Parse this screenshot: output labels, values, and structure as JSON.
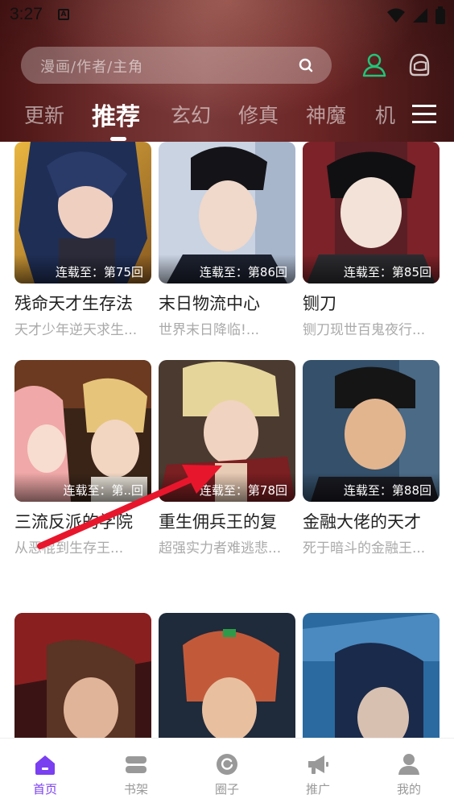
{
  "status_bar": {
    "time": "3:27",
    "a_badge": "A"
  },
  "search": {
    "placeholder": "漫画/作者/主角"
  },
  "tabs": [
    {
      "label": "更新"
    },
    {
      "label": "推荐"
    },
    {
      "label": "玄幻"
    },
    {
      "label": "修真"
    },
    {
      "label": "神魔"
    },
    {
      "label": "机"
    }
  ],
  "active_tab": "推荐",
  "comics": [
    {
      "title": "残命天才生存法",
      "desc": "天才少年逆天求生...",
      "badge": "连载至：第75回"
    },
    {
      "title": "末日物流中心",
      "desc": "世界末日降临!...",
      "badge": "连载至：第86回"
    },
    {
      "title": "铡刀",
      "desc": "铡刀现世百鬼夜行...",
      "badge": "连载至：第85回"
    },
    {
      "title": "三流反派的学院",
      "desc": "从恶棍到生存王...",
      "badge": "连载至：第..回"
    },
    {
      "title": "重生佣兵王的复",
      "desc": "超强实力者难逃悲...",
      "badge": "连载至：第78回"
    },
    {
      "title": "金融大佬的天才",
      "desc": "死于暗斗的金融王...",
      "badge": "连载至：第88回"
    },
    {
      "title": "",
      "desc": "",
      "badge": ""
    },
    {
      "title": "",
      "desc": "",
      "badge": ""
    },
    {
      "title": "",
      "desc": "",
      "badge": ""
    }
  ],
  "bottom_nav": [
    {
      "label": "首页",
      "icon": "home-icon"
    },
    {
      "label": "书架",
      "icon": "bookshelf-icon"
    },
    {
      "label": "圈子",
      "icon": "circle-icon"
    },
    {
      "label": "推广",
      "icon": "megaphone-icon"
    },
    {
      "label": "我的",
      "icon": "profile-icon"
    }
  ],
  "colors": {
    "accent": "#7a3ff0",
    "user_icon": "#22c47a",
    "header_bg": "#6b2a2a",
    "arrow": "#e8162c"
  }
}
